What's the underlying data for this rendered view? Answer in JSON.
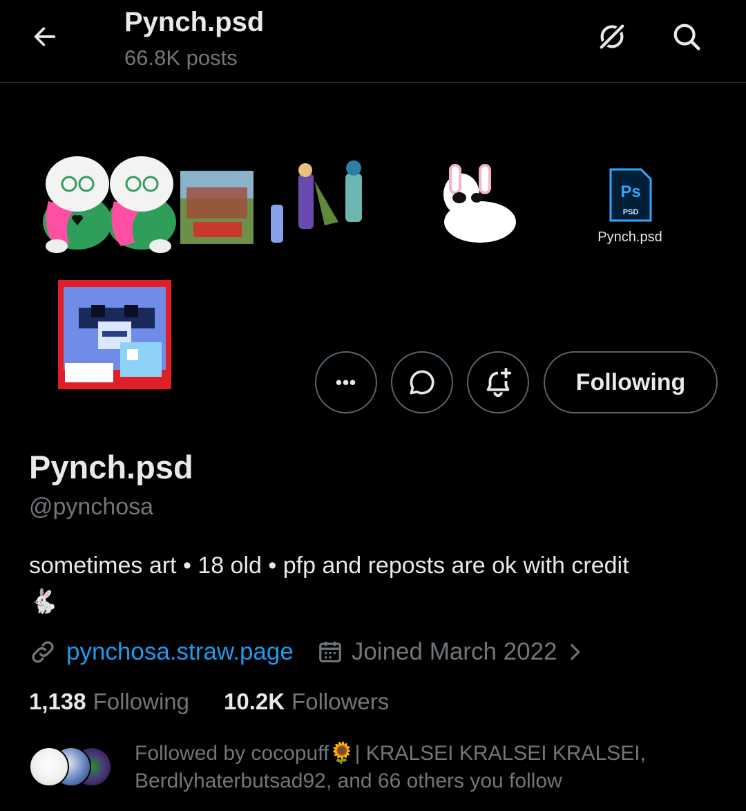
{
  "header": {
    "title": "Pynch.psd",
    "post_count": "66.8K posts"
  },
  "banner": {
    "ps_badge": "Ps",
    "ps_sub": "PSD",
    "file_caption": "Pynch.psd"
  },
  "actions": {
    "more": "•••",
    "follow_label": "Following"
  },
  "profile": {
    "display_name": "Pynch.psd",
    "handle": "@pynchosa",
    "bio": "sometimes art • 18 old • pfp and reposts are ok with credit",
    "bio_emoji": "🐇",
    "link": "pynchosa.straw.page",
    "joined": "Joined March 2022"
  },
  "stats": {
    "following_count": "1,138",
    "following_label": "Following",
    "followers_count": "10.2K",
    "followers_label": "Followers"
  },
  "followed_by": {
    "text_line1": "Followed by cocopuff🌻| KRALSEI KRALSEI KRALSEI,",
    "text_line2": "Berdlyhaterbutsad92, and 66 others you follow"
  },
  "colors": {
    "background": "#000000",
    "link": "#1d9bf0",
    "muted": "#71767b",
    "border": "#536471"
  },
  "icons": {
    "back": "arrow-left-icon",
    "grok": "grok-icon",
    "search": "search-icon",
    "more": "more-icon",
    "message": "message-icon",
    "notify": "bell-plus-icon",
    "link": "link-icon",
    "calendar": "calendar-icon",
    "chevron": "chevron-right-icon"
  }
}
